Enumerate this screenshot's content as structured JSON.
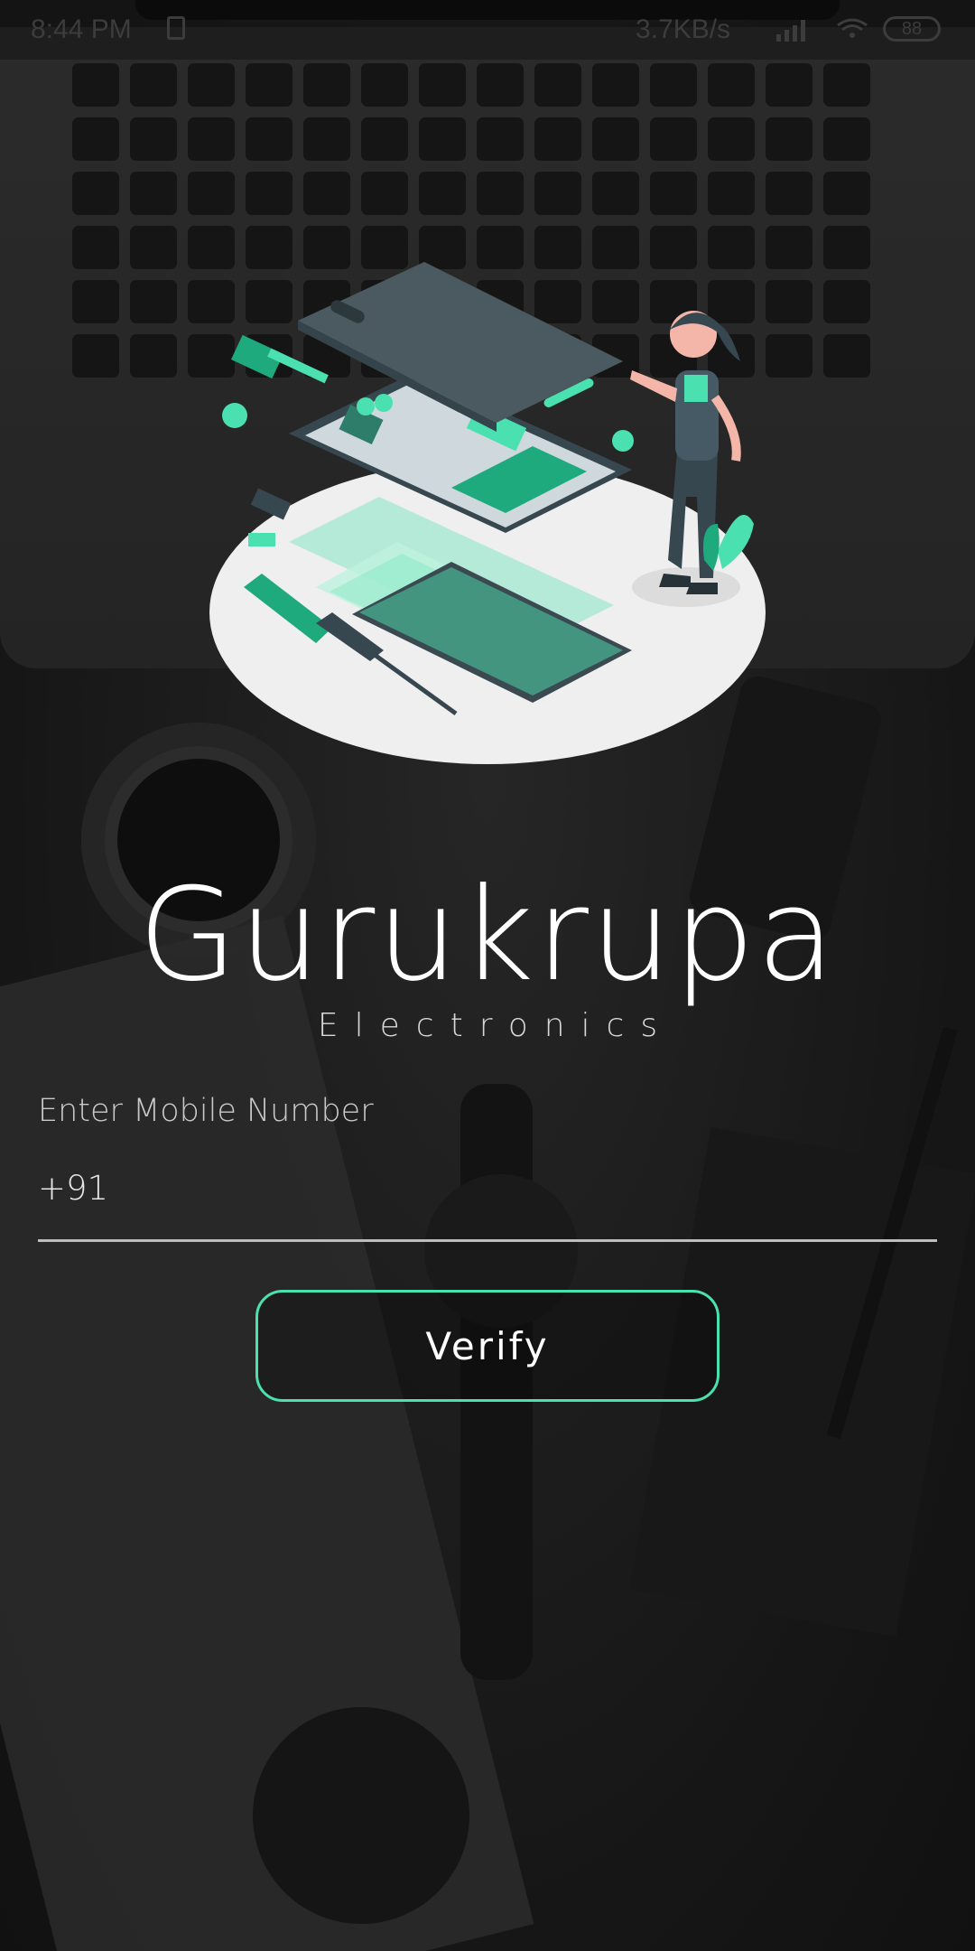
{
  "status_bar": {
    "time": "8:44 PM",
    "network_speed": "3.7KB/s",
    "battery": "88"
  },
  "brand": {
    "title": "Gurukrupa",
    "subtitle": "Electronics"
  },
  "form": {
    "mobile_label": "Enter Mobile Number",
    "mobile_value": "+91",
    "verify_label": "Verify"
  },
  "colors": {
    "accent": "#4be0b0",
    "background": "#1b1b1b",
    "text": "#ffffff"
  },
  "icons": {
    "illustration": "phone-repair-illustration",
    "status": [
      "alarm-icon",
      "signal-icon",
      "wifi-icon",
      "battery-icon"
    ]
  }
}
